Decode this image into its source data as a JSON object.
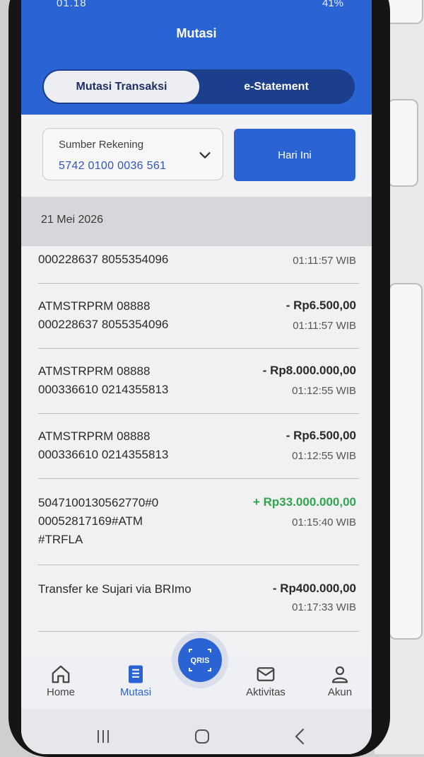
{
  "status_bar": {
    "time": "01.18",
    "battery": "41%"
  },
  "header": {
    "title": "Mutasi",
    "tabs": [
      {
        "label": "Mutasi Transaksi"
      },
      {
        "label": "e-Statement"
      }
    ]
  },
  "filter": {
    "account_label": "Sumber Rekening",
    "account_number": "5742 0100 0036 561",
    "period_button": "Hari Ini"
  },
  "date_header": "21 Mei 2026",
  "transactions": [
    {
      "line1": "000228637 8055354096",
      "line2": "",
      "line3": "",
      "amount": "",
      "time": "01:11:57 WIB"
    },
    {
      "line1": "ATMSTRPRM 08888",
      "line2": "000228637 8055354096",
      "line3": "",
      "amount": "- Rp6.500,00",
      "time": "01:11:57 WIB"
    },
    {
      "line1": "ATMSTRPRM 08888",
      "line2": "000336610 0214355813",
      "line3": "",
      "amount": "- Rp8.000.000,00",
      "time": "01:12:55 WIB"
    },
    {
      "line1": "ATMSTRPRM 08888",
      "line2": "000336610 0214355813",
      "line3": "",
      "amount": "- Rp6.500,00",
      "time": "01:12:55 WIB"
    },
    {
      "line1": "5047100130562770#0",
      "line2": "00052817169#ATM",
      "line3": "#TRFLA",
      "amount": "+ Rp33.000.000,00",
      "time": "01:15:40 WIB"
    },
    {
      "line1": "Transfer ke Sujari via BRImo",
      "line2": "",
      "line3": "",
      "amount": "- Rp400.000,00",
      "time": "01:17:33 WIB"
    }
  ],
  "bottom_nav": {
    "items": [
      {
        "label": "Home",
        "icon": "home-icon"
      },
      {
        "label": "Mutasi",
        "icon": "document-list-icon"
      },
      {
        "label": "Aktivitas",
        "icon": "envelope-icon"
      },
      {
        "label": "Akun",
        "icon": "person-icon"
      }
    ],
    "qris_label": "QRIS"
  },
  "colors": {
    "primary": "#2a63d3",
    "credit": "#2fa64e",
    "text": "#2a2a2a"
  }
}
